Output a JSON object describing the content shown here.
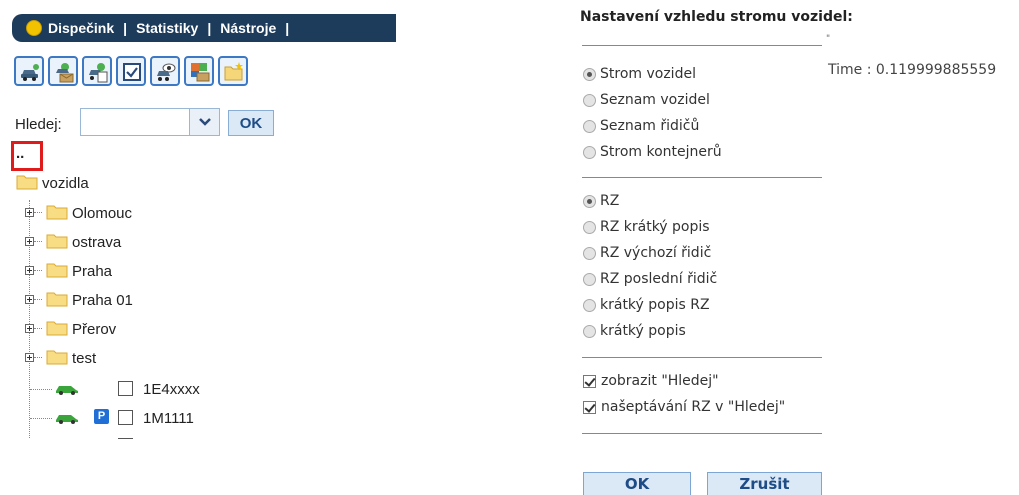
{
  "nav": {
    "items": [
      "Dispečink",
      "Statistiky",
      "Nástroje"
    ],
    "separator": "|"
  },
  "toolbar": {
    "icons": [
      "car-key-icon",
      "car-mail-icon",
      "car-documents-icon",
      "checklist-icon",
      "car-eye-icon",
      "people-mail-icon",
      "new-folder-icon"
    ]
  },
  "search": {
    "label": "Hledej:",
    "value": "",
    "ok_label": "OK"
  },
  "tree": {
    "up": "..",
    "root": "vozidla",
    "folders": [
      "Olomouc",
      "ostrava",
      "Praha",
      "Praha 01",
      "Přerov",
      "test"
    ],
    "vehicles": [
      {
        "plate": "1E4xxxx",
        "parked": false
      },
      {
        "plate": "1M1111",
        "parked": true
      }
    ],
    "parked_badge": "P"
  },
  "settings": {
    "title": "Nastavení vzhledu stromu vozidel:",
    "mark": "\"",
    "view_options": [
      {
        "label": "Strom vozidel",
        "selected": true
      },
      {
        "label": "Seznam vozidel",
        "selected": false
      },
      {
        "label": "Seznam řidičů",
        "selected": false
      },
      {
        "label": "Strom kontejnerů",
        "selected": false
      }
    ],
    "label_options": [
      {
        "label": "RZ",
        "selected": true
      },
      {
        "label": "RZ krátký popis",
        "selected": false
      },
      {
        "label": "RZ výchozí řidič",
        "selected": false
      },
      {
        "label": "RZ poslední řidič",
        "selected": false
      },
      {
        "label": "krátký popis RZ",
        "selected": false
      },
      {
        "label": "krátký popis",
        "selected": false
      }
    ],
    "checkboxes": [
      {
        "label": "zobrazit \"Hledej\"",
        "checked": true
      },
      {
        "label": "našeptávání RZ v \"Hledej\"",
        "checked": true
      }
    ],
    "ok_label": "OK",
    "cancel_label": "Zrušit"
  },
  "time_text": "Time : 0.119999885559"
}
